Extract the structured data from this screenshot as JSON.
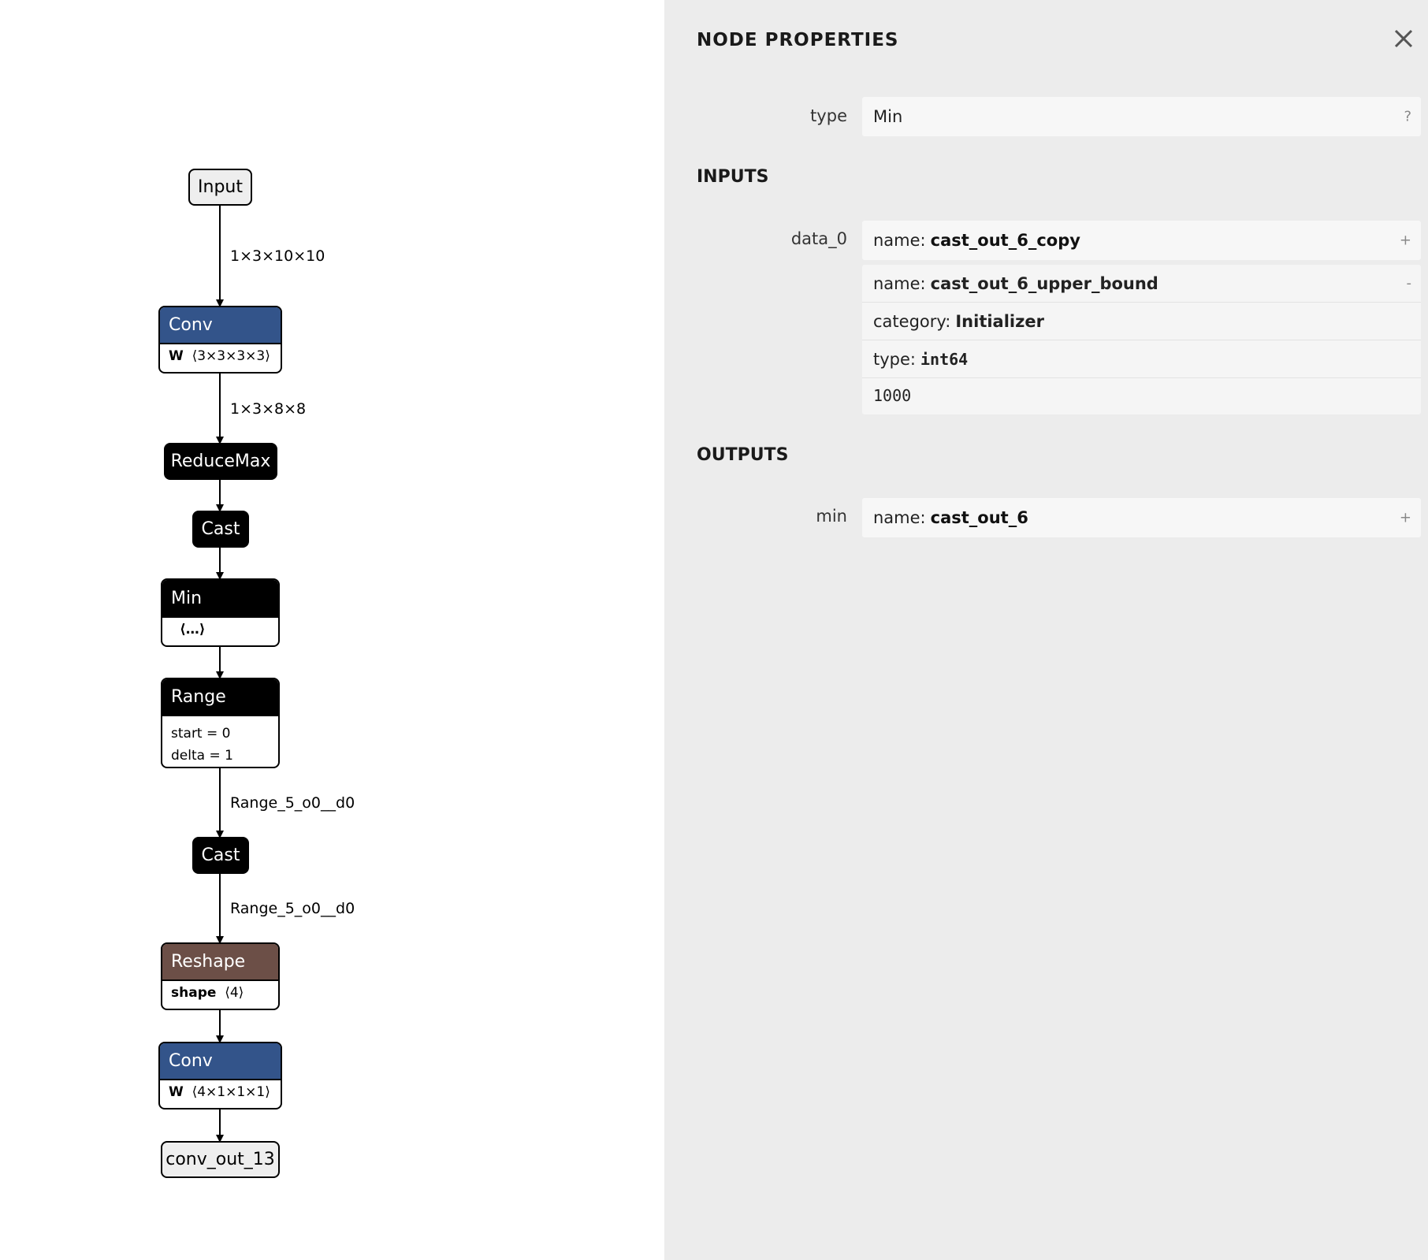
{
  "graph": {
    "nodes": {
      "input": "Input",
      "conv1": {
        "title": "Conv",
        "param_name": "W",
        "param_value": "⟨3×3×3×3⟩"
      },
      "reducemax": "ReduceMax",
      "cast1": "Cast",
      "min": {
        "title": "Min",
        "body": "⟨…⟩"
      },
      "range": {
        "title": "Range",
        "attr1": "start = 0",
        "attr2": "delta = 1"
      },
      "cast2": "Cast",
      "reshape": {
        "title": "Reshape",
        "param_name": "shape",
        "param_value": "⟨4⟩"
      },
      "conv2": {
        "title": "Conv",
        "param_name": "W",
        "param_value": "⟨4×1×1×1⟩"
      },
      "output": "conv_out_13"
    },
    "edges": {
      "input_conv": "1×3×10×10",
      "conv_reducemax": "1×3×8×8",
      "range_cast": "Range_5_o0__d0",
      "cast_reshape": "Range_5_o0__d0"
    },
    "colors": {
      "conv": "#33548a",
      "op": "#000000",
      "reshape": "#6c4f47",
      "io": "#eeeeee"
    }
  },
  "panel": {
    "title": "NODE PROPERTIES",
    "close_icon": "close-icon",
    "type_label": "type",
    "type_value": "Min",
    "type_help": "?",
    "inputs_header": "INPUTS",
    "input_name": "data_0",
    "input1": {
      "key": "name:",
      "value": "cast_out_6_copy",
      "toggle": "+"
    },
    "input2": {
      "key": "name:",
      "value": "cast_out_6_upper_bound",
      "toggle": "-",
      "category_key": "category:",
      "category_value": "Initializer",
      "type_key": "type:",
      "type_value": "int64",
      "tensor_value": "1000"
    },
    "outputs_header": "OUTPUTS",
    "output_name": "min",
    "output1": {
      "key": "name:",
      "value": "cast_out_6",
      "toggle": "+"
    }
  }
}
